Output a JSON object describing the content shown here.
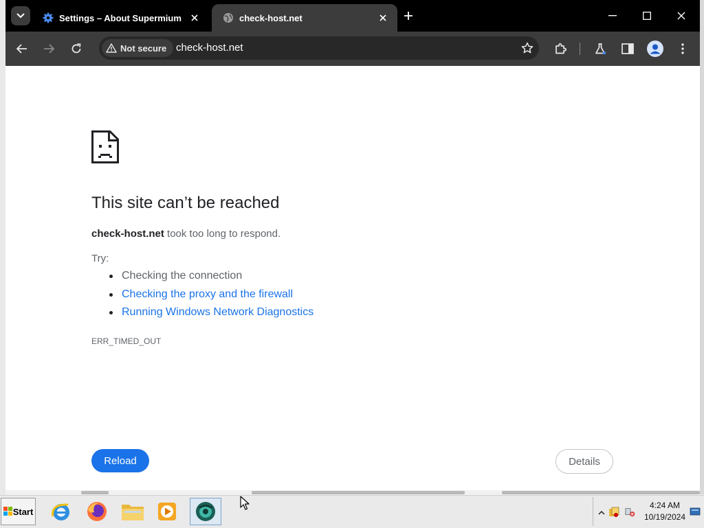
{
  "browser": {
    "tabs": [
      {
        "title": "Settings – About Supermium",
        "icon": "gear-icon"
      },
      {
        "title": "check-host.net",
        "icon": "globe-icon"
      }
    ],
    "omnibox": {
      "security_label": "Not secure",
      "url": "check-host.net"
    }
  },
  "error_page": {
    "headline": "This site can’t be reached",
    "host": "check-host.net",
    "description_suffix": " took too long to respond.",
    "try_label": "Try:",
    "suggestions": [
      {
        "text": "Checking the connection",
        "link": false
      },
      {
        "text": "Checking the proxy and the firewall",
        "link": true
      },
      {
        "text": "Running Windows Network Diagnostics",
        "link": true
      }
    ],
    "error_code": "ERR_TIMED_OUT",
    "reload_label": "Reload",
    "details_label": "Details"
  },
  "taskbar": {
    "start_label": "Start",
    "apps": [
      "internet-explorer-icon",
      "firefox-icon",
      "file-explorer-icon",
      "media-player-icon",
      "supermium-icon"
    ],
    "clock_time": "4:24 AM",
    "clock_date": "10/19/2024"
  },
  "colors": {
    "link": "#1a73e8",
    "tabstrip": "#000000",
    "toolbar": "#3c3c3c"
  }
}
